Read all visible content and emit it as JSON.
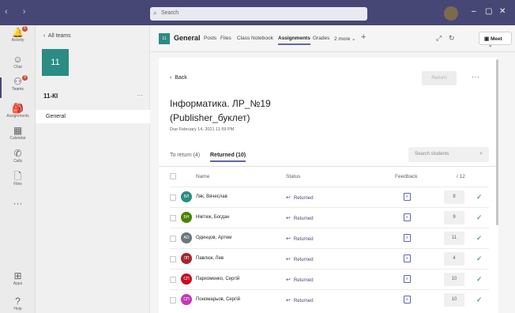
{
  "titlebar": {
    "nav": "‹ ›",
    "search_placeholder": "Search",
    "minimize": "–",
    "maximize": "▢",
    "close": "✕"
  },
  "rail": {
    "items": [
      {
        "label": "Activity",
        "icon": "bell-icon",
        "glyph": "🔔",
        "badge": "5"
      },
      {
        "label": "Chat",
        "icon": "chat-icon",
        "glyph": "☺",
        "badge": ""
      },
      {
        "label": "Teams",
        "icon": "teams-icon",
        "glyph": "⚇",
        "badge": "9"
      },
      {
        "label": "Assignments",
        "icon": "assignments-icon",
        "glyph": "🎒",
        "badge": ""
      },
      {
        "label": "Calendar",
        "icon": "calendar-icon",
        "glyph": "▦",
        "badge": ""
      },
      {
        "label": "Calls",
        "icon": "phone-icon",
        "glyph": "✆",
        "badge": ""
      },
      {
        "label": "Files",
        "icon": "files-icon",
        "glyph": "🗋",
        "badge": ""
      },
      {
        "label": "",
        "icon": "more-icon",
        "glyph": "···",
        "badge": ""
      },
      {
        "label": "Apps",
        "icon": "apps-icon",
        "glyph": "⊞",
        "badge": ""
      },
      {
        "label": "Help",
        "icon": "help-icon",
        "glyph": "?",
        "badge": ""
      }
    ]
  },
  "team_pane": {
    "all_teams": "All teams",
    "tile_label": "11",
    "team_name": "11-КІ",
    "more": "···",
    "channel": "General"
  },
  "channel_header": {
    "tile_label": "11",
    "channel": "General",
    "tabs": [
      "Posts",
      "Files",
      "Class Notebook",
      "Assignments",
      "Grades",
      "2 more ⌄"
    ],
    "active_tab": "Assignments",
    "add": "+",
    "meet": "Meet"
  },
  "assignment": {
    "back": "Back",
    "return_button": "Return",
    "more": "···",
    "title_line1": "Інформатика. ЛР_№19",
    "title_line2": "(Publisher_буклет)",
    "due": "Due February 14, 2021 11:59 PM",
    "tab_to_return": "To return (4)",
    "tab_returned": "Returned (10)",
    "search_placeholder": "Search students",
    "col_name": "Name",
    "col_status": "Status",
    "col_feedback": "Feedback",
    "col_points": "/ 12"
  },
  "students": [
    {
      "initials": "ВЛ",
      "name": "Ляк, Вячеслав",
      "status": "Returned",
      "points": "8",
      "color": "#2a8c82"
    },
    {
      "initials": "БН",
      "name": "Нікітюк, Богдан",
      "status": "Returned",
      "points": "9",
      "color": "#498205"
    },
    {
      "initials": "АО",
      "name": "Одинцов, Артем",
      "status": "Returned",
      "points": "11",
      "color": "#69797e"
    },
    {
      "initials": "ЛП",
      "name": "Павлюк, Лев",
      "status": "Returned",
      "points": "4",
      "color": "#a4262c"
    },
    {
      "initials": "СП",
      "name": "Пархоменко, Сергій",
      "status": "Returned",
      "points": "10",
      "color": "#c50f1f"
    },
    {
      "initials": "СП",
      "name": "Пономарьов, Сергій",
      "status": "Returned",
      "points": "10",
      "color": "#c239b3"
    }
  ]
}
